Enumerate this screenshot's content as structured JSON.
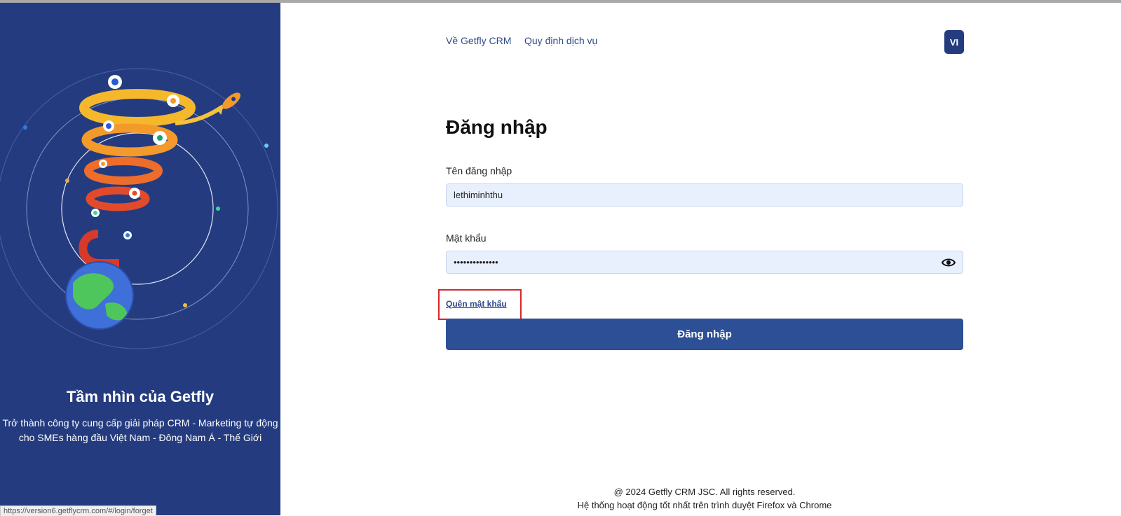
{
  "nav": {
    "about": "Về Getfly CRM",
    "terms": "Quy định dịch vụ",
    "lang": "VI"
  },
  "vision": {
    "title": "Tầm nhìn của Getfly",
    "line1": "Trở thành công ty cung cấp giải pháp CRM - Marketing tự động",
    "line2": "cho SMEs hàng đầu Việt Nam - Đông Nam Á - Thế Giới"
  },
  "login": {
    "title": "Đăng nhập",
    "username_label": "Tên đăng nhập",
    "username_value": "lethiminhthu",
    "password_label": "Mật khẩu",
    "password_value": "••••••••••••••",
    "forgot": "Quên mật khẩu",
    "submit": "Đăng nhập"
  },
  "footer": {
    "copyright": "@ 2024 Getfly CRM JSC. All rights reserved.",
    "browser_note": "Hệ thống hoạt động tốt nhất trên trình duyệt Firefox và Chrome"
  },
  "status_bar": {
    "url": "https://version6.getflycrm.com/#/login/forget"
  },
  "colors": {
    "panel": "#243c7f",
    "accent": "#2c4f96",
    "highlight": "#d9262b"
  },
  "icons": {
    "password_toggle": "eye-icon"
  }
}
